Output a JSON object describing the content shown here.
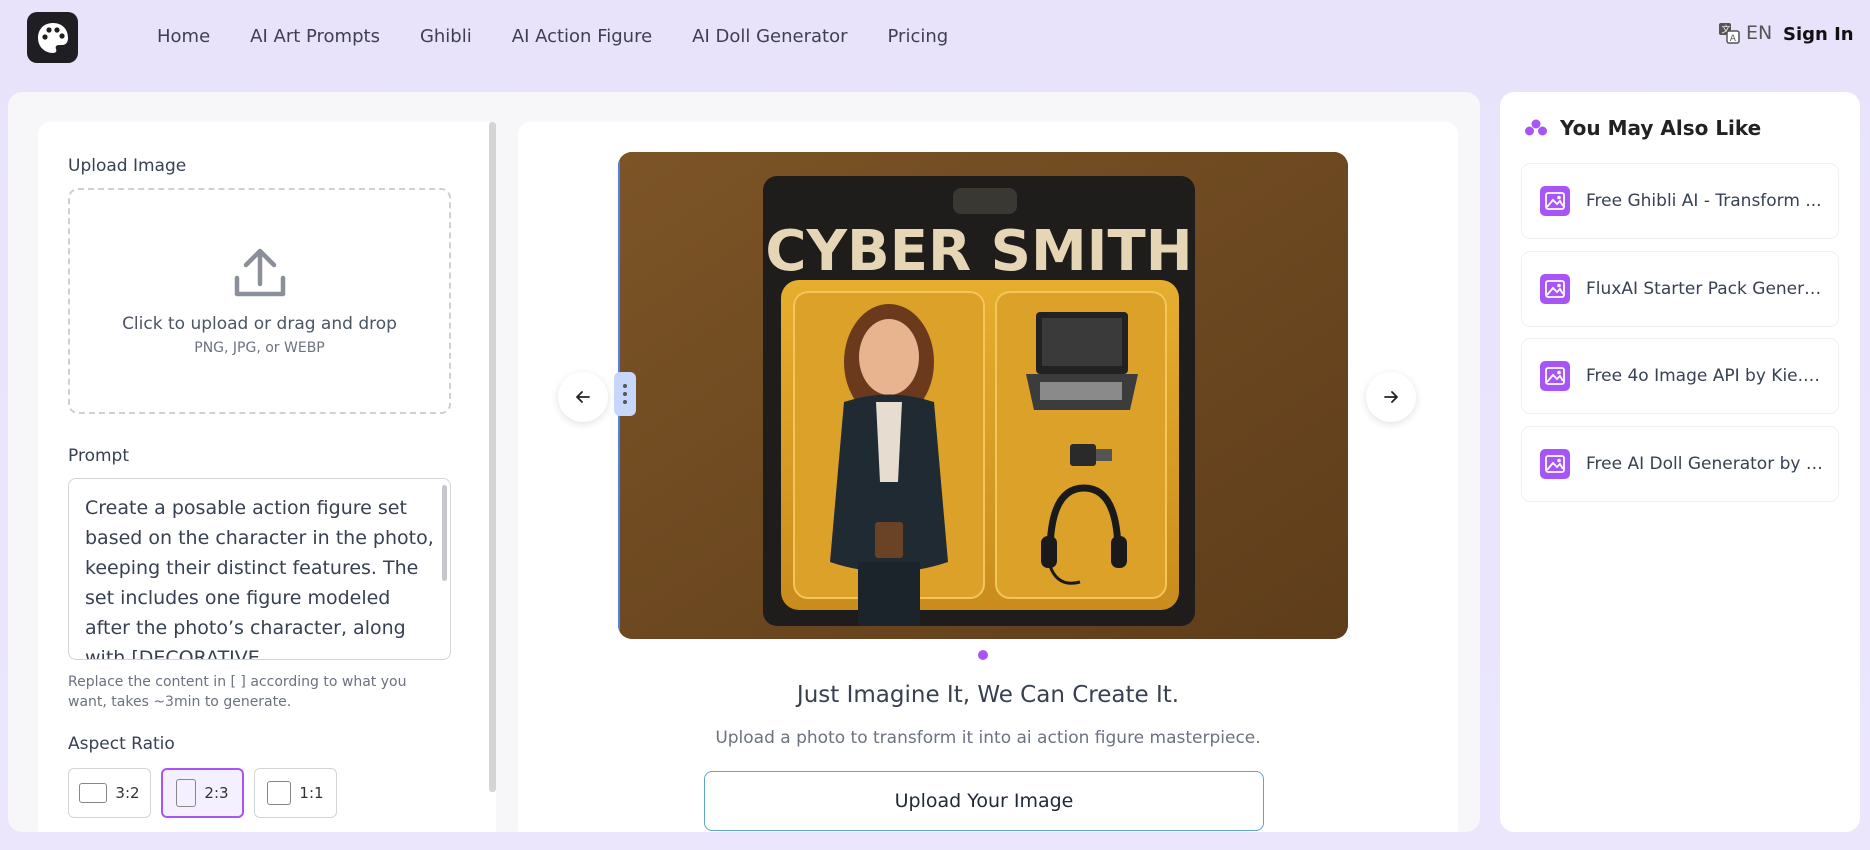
{
  "nav": {
    "items": [
      "Home",
      "AI Art Prompts",
      "Ghibli",
      "AI Action Figure",
      "AI Doll Generator",
      "Pricing"
    ],
    "lang": "EN",
    "signin": "Sign In"
  },
  "upload": {
    "label": "Upload Image",
    "title": "Click to upload or drag and drop",
    "formats": "PNG, JPG, or WEBP"
  },
  "prompt": {
    "label": "Prompt",
    "text": "Create a posable action figure set based on the character in the photo, keeping their distinct features. The set includes one figure modeled after the photo’s character, along with [DECORATIVE",
    "hint": "Replace the content in [ ] according to what you want, takes ~3min to generate."
  },
  "aspect": {
    "label": "Aspect Ratio",
    "options": [
      "3:2",
      "2:3",
      "1:1"
    ],
    "selected": "2:3"
  },
  "preview": {
    "figure_title": "CYBER SMITH",
    "tagline": "Just Imagine It, We Can Create It.",
    "subline": "Upload a photo to transform it into ai action figure masterpiece.",
    "upload_button": "Upload Your Image"
  },
  "sidebar": {
    "title": "You May Also Like",
    "items": [
      "Free Ghibli AI - Transform ...",
      "FluxAI Starter Pack Genera...",
      "Free 4o Image API by Kie.A...",
      "Free AI Doll Generator by F..."
    ]
  },
  "colors": {
    "accent": "#a855f7",
    "brand_dark": "#1f1f23"
  }
}
